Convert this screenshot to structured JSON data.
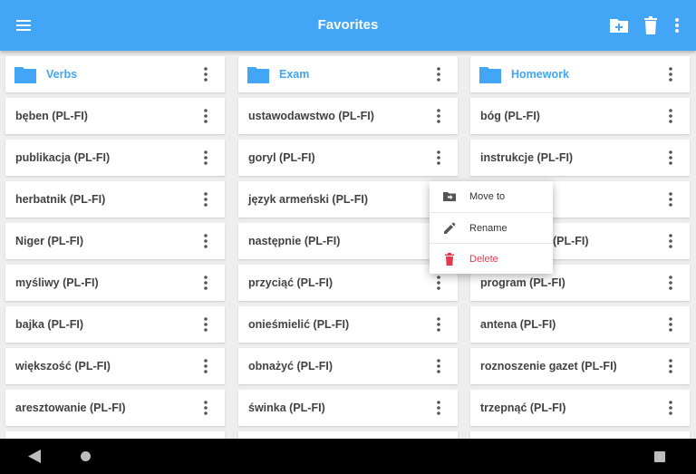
{
  "header": {
    "title": "Favorites",
    "icons": [
      "menu-icon",
      "folder-add-icon",
      "trash-icon",
      "more-vert-icon"
    ]
  },
  "colors": {
    "primary": "#42a5f5",
    "delete": "#e53950",
    "text": "#424242",
    "background": "#eeeeee"
  },
  "columns": [
    {
      "folder": "Verbs",
      "items": [
        "bęben (PL-FI)",
        "publikacja (PL-FI)",
        "herbatnik (PL-FI)",
        "Niger (PL-FI)",
        "myśliwy (PL-FI)",
        "bajka (PL-FI)",
        "większość (PL-FI)",
        "aresztowanie (PL-FI)"
      ]
    },
    {
      "folder": "Exam",
      "items": [
        "ustawodawstwo (PL-FI)",
        "goryl (PL-FI)",
        "język armeński (PL-FI)",
        "następnie (PL-FI)",
        "przyciąć (PL-FI)",
        "onieśmielić (PL-FI)",
        "obnażyć (PL-FI)",
        "świnka (PL-FI)"
      ]
    },
    {
      "folder": "Homework",
      "items": [
        "bóg (PL-FI)",
        "instrukcje (PL-FI)",
        "",
        "(PL-FI)",
        "program (PL-FI)",
        "antena (PL-FI)",
        "roznoszenie gazet (PL-FI)",
        "trzepnąć (PL-FI)"
      ]
    }
  ],
  "context_menu": {
    "items": [
      {
        "label": "Move to",
        "icon": "move-to-folder-icon"
      },
      {
        "label": "Rename",
        "icon": "pencil-icon"
      },
      {
        "label": "Delete",
        "icon": "trash-icon"
      }
    ]
  },
  "navbar": {
    "icons": [
      "back-icon",
      "home-icon",
      "recents-icon"
    ]
  }
}
